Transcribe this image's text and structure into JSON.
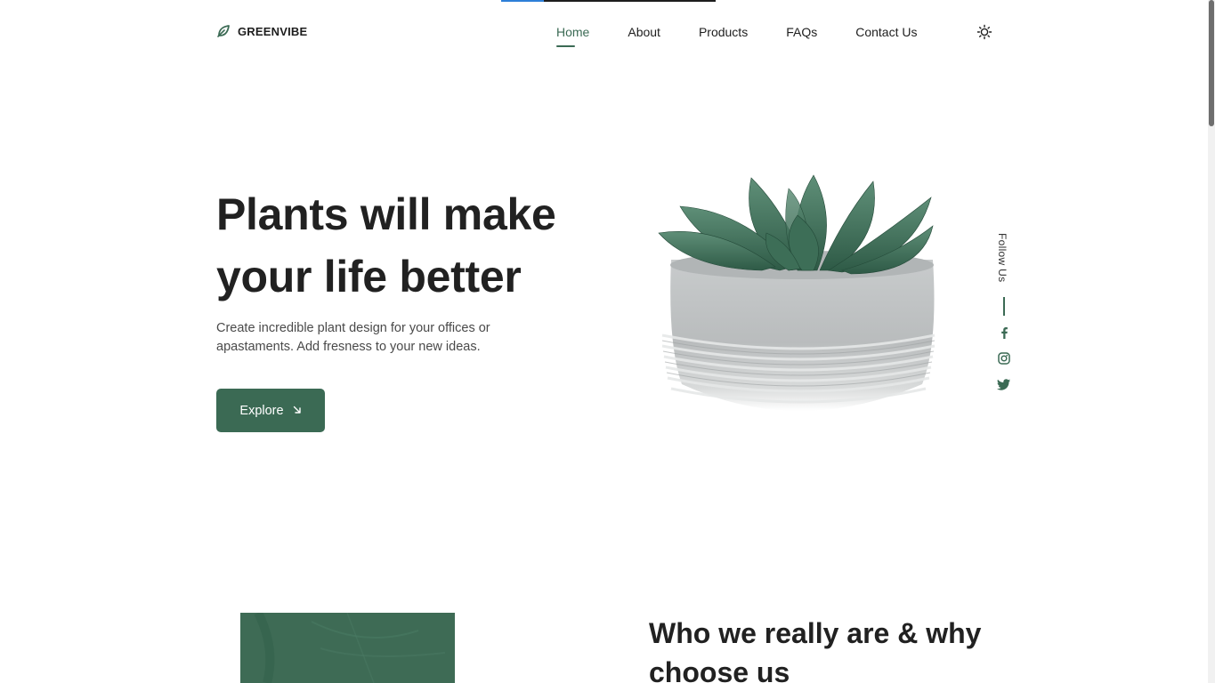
{
  "header": {
    "logo_text": "GREENVIBE",
    "nav": [
      {
        "label": "Home",
        "active": true
      },
      {
        "label": "About",
        "active": false
      },
      {
        "label": "Products",
        "active": false
      },
      {
        "label": "FAQs",
        "active": false
      },
      {
        "label": "Contact Us",
        "active": false
      }
    ],
    "theme_icon": "sun-icon"
  },
  "hero": {
    "title": "Plants will make your life better",
    "description": "Create incredible plant design for your offices or apastaments. Add fresness to your new ideas.",
    "explore_label": "Explore",
    "explore_icon": "arrow-down-right-icon"
  },
  "follow": {
    "label": "Follow Us",
    "icons": [
      "facebook-icon",
      "instagram-icon",
      "twitter-icon"
    ]
  },
  "about": {
    "title": "Who we really are & why choose us"
  },
  "colors": {
    "accent": "#3b6a54",
    "text": "#212121"
  },
  "scroll_progress": 0.2
}
